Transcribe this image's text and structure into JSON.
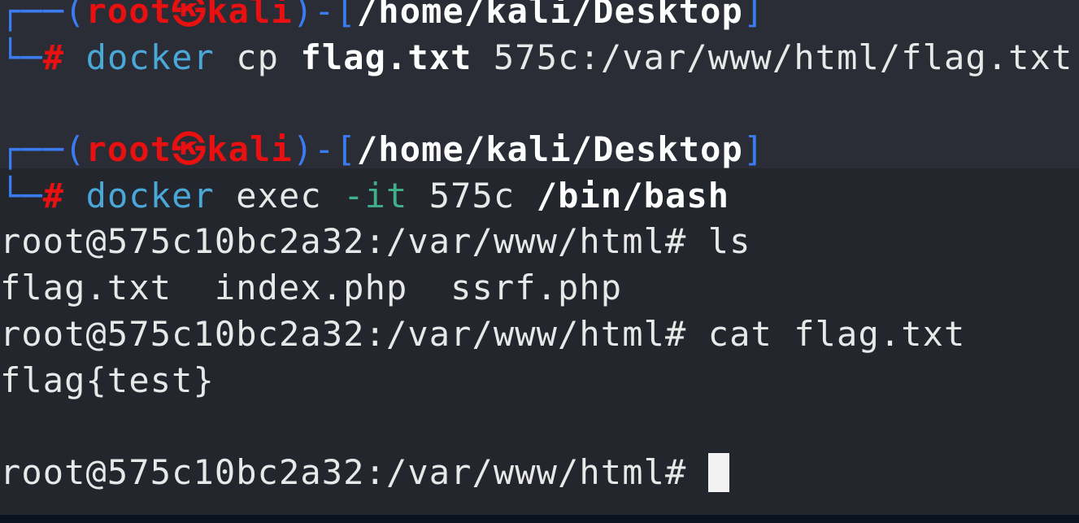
{
  "prompts": [
    {
      "corner_top": "┌──(",
      "user": "root",
      "skull": "㉿",
      "host": "kali",
      "mid": ")-[",
      "path": "/home/kali/Desktop",
      "end": "]",
      "corner_bot": "└─",
      "hash": "#",
      "cmd": "docker",
      "args": [
        {
          "t": " cp ",
          "s": "plain"
        },
        {
          "t": "flag.txt",
          "s": "bold"
        },
        {
          "t": " 575c:/var/www/html/flag.txt",
          "s": "plain"
        }
      ]
    },
    {
      "corner_top": "┌──(",
      "user": "root",
      "skull": "㉿",
      "host": "kali",
      "mid": ")-[",
      "path": "/home/kali/Desktop",
      "end": "]",
      "corner_bot": "└─",
      "hash": "#",
      "cmd": "docker",
      "args": [
        {
          "t": " exec ",
          "s": "plain"
        },
        {
          "t": "-it",
          "s": "green"
        },
        {
          "t": " 575c ",
          "s": "plain"
        },
        {
          "t": "/bin/bash",
          "s": "bold"
        }
      ]
    }
  ],
  "output": [
    "root@575c10bc2a32:/var/www/html# ls",
    "flag.txt  index.php  ssrf.php",
    "root@575c10bc2a32:/var/www/html# cat flag.txt",
    "flag{test}",
    "",
    "root@575c10bc2a32:/var/www/html# "
  ]
}
